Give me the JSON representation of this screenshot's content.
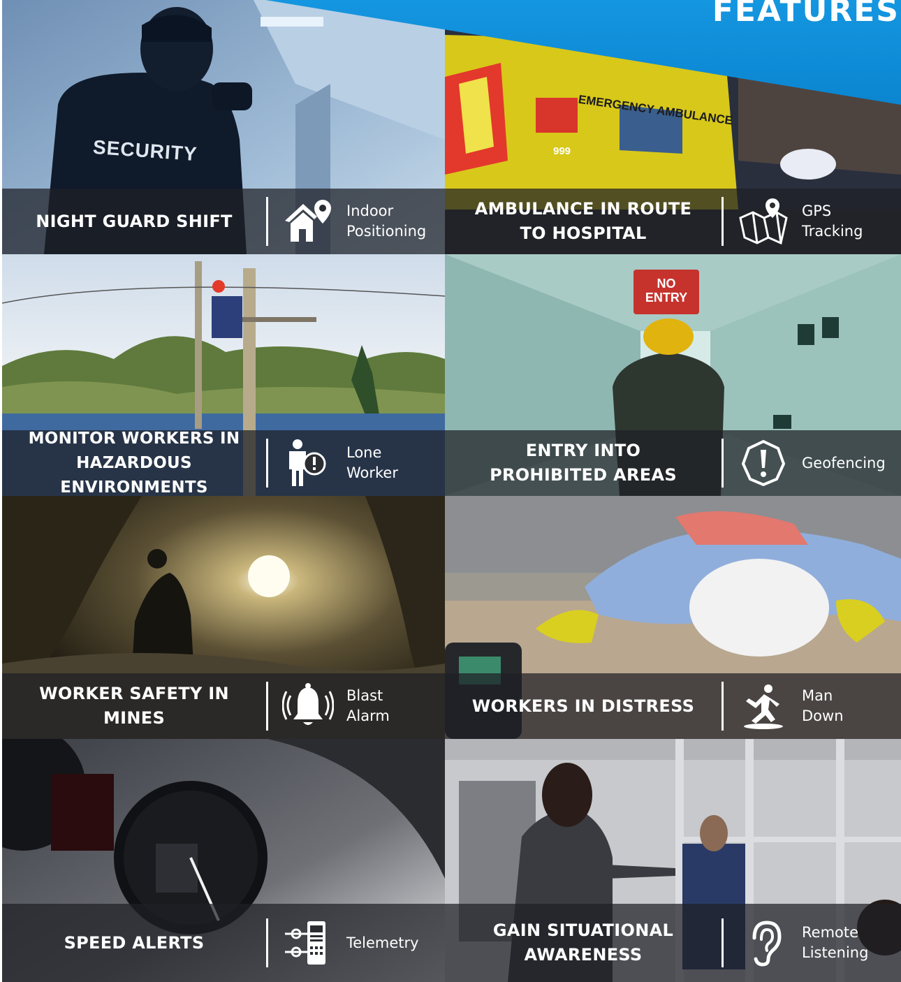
{
  "header": {
    "title": "FEATURES"
  },
  "tiles": [
    {
      "title": "NIGHT GUARD SHIFT",
      "feature": "Indoor\nPositioning",
      "icon": "house-location-icon"
    },
    {
      "title": "AMBULANCE IN ROUTE\nTO HOSPITAL",
      "feature": "GPS\nTracking",
      "icon": "map-pin-icon"
    },
    {
      "title": "MONITOR WORKERS IN\nHAZARDOUS ENVIRONMENTS",
      "feature": "Lone\nWorker",
      "icon": "person-alert-icon"
    },
    {
      "title": "ENTRY INTO\nPROHIBITED AREAS",
      "feature": "Geofencing",
      "icon": "shield-exclamation-icon"
    },
    {
      "title": "WORKER SAFETY IN MINES",
      "feature": "Blast\nAlarm",
      "icon": "alarm-bell-icon"
    },
    {
      "title": "WORKERS IN DISTRESS",
      "feature": "Man\nDown",
      "icon": "man-falling-icon"
    },
    {
      "title": "SPEED ALERTS",
      "feature": "Telemetry",
      "icon": "telemetry-device-icon"
    },
    {
      "title": "GAIN SITUATIONAL\nAWARENESS",
      "feature": "Remote\nListening",
      "icon": "ear-icon"
    }
  ],
  "photo_labels": {
    "security_jacket": "SECURITY",
    "ambulance_side": "EMERGENCY AMBULANCE",
    "ambulance_number": "999",
    "sign": "NO\nENTRY"
  },
  "colors": {
    "banner": "#0a84cf",
    "bar": "#1e2026"
  }
}
